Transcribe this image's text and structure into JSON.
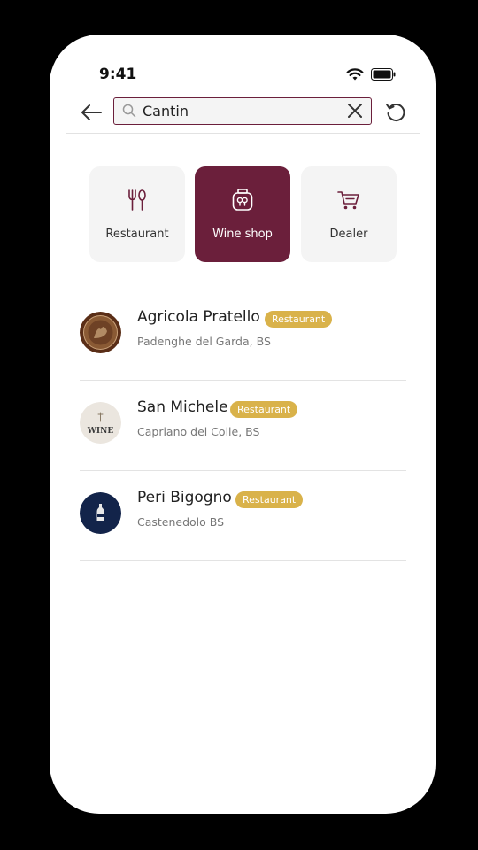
{
  "status_bar": {
    "time": "9:41"
  },
  "search": {
    "value": "Cantin"
  },
  "categories": [
    {
      "label": "Restaurant",
      "icon": "fork-knife-icon",
      "active": false
    },
    {
      "label": "Wine shop",
      "icon": "wine-jar-icon",
      "active": true
    },
    {
      "label": "Dealer",
      "icon": "cart-icon",
      "active": false
    }
  ],
  "results": [
    {
      "name": "Agricola Pratello",
      "badge": "Restaurant",
      "address": "Padenghe del Garda, BS"
    },
    {
      "name": "San Michele",
      "badge": "Restaurant",
      "address": "Capriano del Colle, BS",
      "logo_text": "WINE"
    },
    {
      "name": "Peri Bigogno",
      "badge": "Restaurant",
      "address": "Castenedolo BS"
    }
  ],
  "colors": {
    "accent": "#6b1f3b",
    "badge": "#d9b24a",
    "tile_bg": "#f4f4f4"
  }
}
